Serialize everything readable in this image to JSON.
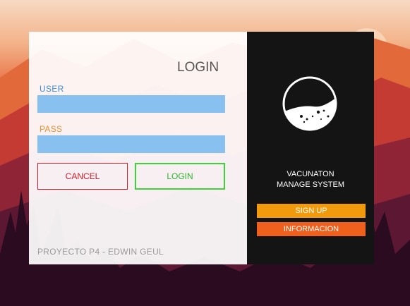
{
  "login_panel": {
    "title": "LOGIN",
    "user_label": "USER",
    "user_value": "",
    "pass_label": "PASS",
    "pass_value": "",
    "cancel_label": "CANCEL",
    "login_label": "LOGIN",
    "footer": "PROYECTO P4 - EDWIN GEUL"
  },
  "side_panel": {
    "system_name_line1": "VACUNATON",
    "system_name_line2": "MANAGE SYSTEM",
    "signup_label": "SIGN UP",
    "info_label": "INFORMACION"
  },
  "colors": {
    "user_label": "#3f8bd6",
    "pass_label": "#e39235",
    "input_bg": "#88c1ef",
    "cancel": "#d21d2b",
    "login": "#3fd03a",
    "signup": "#f19b0c",
    "info": "#f0601d",
    "side_panel_bg": "#151414"
  },
  "icons": {
    "logo": "vaccine-vial-logo-icon"
  }
}
